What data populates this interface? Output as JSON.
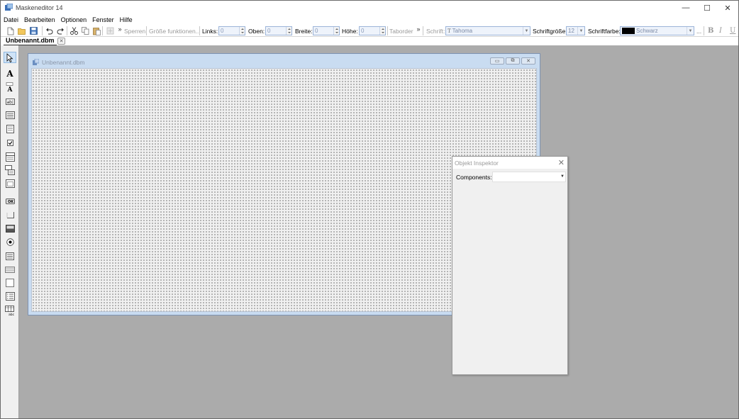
{
  "window": {
    "title": "Maskeneditor 14",
    "minimize_glyph": "—",
    "maximize_glyph": "☐",
    "close_glyph": "✕"
  },
  "menu": [
    {
      "label": "Datei"
    },
    {
      "label": "Bearbeiten"
    },
    {
      "label": "Optionen"
    },
    {
      "label": "Fenster"
    },
    {
      "label": "Hilfe"
    }
  ],
  "toolbar": {
    "lock_label": "Sperren",
    "size_functions_label": "Größe funktionen...",
    "left_label": "Links:",
    "left_value": "0",
    "top_label": "Oben:",
    "top_value": "0",
    "width_label": "Breite:",
    "width_value": "0",
    "height_label": "Höhe:",
    "height_value": "0",
    "taborder_label": "Taborder",
    "font_label": "Schrift:",
    "font_value": "Tahoma",
    "font_size_label": "Schriftgröße:",
    "font_size_value": "12",
    "font_color_label": "Schriftfarbe:",
    "font_color_value": "Schwarz",
    "font_color_swatch": "#000000",
    "overflow_glyph": "»",
    "ellipsis_label": "...",
    "bold_label": "B",
    "italic_label": "I",
    "underline_label": "U"
  },
  "document_tab": {
    "label": "Unbenannt.dbm"
  },
  "form_window": {
    "title": "Unbenannt.dbm"
  },
  "inspector": {
    "title": "Objekt Inspektor",
    "components_label": "Components:",
    "components_value": ""
  },
  "palette_tools": [
    "pointer",
    "label",
    "db-label",
    "edit",
    "memo",
    "listbox",
    "checkbox",
    "combobox",
    "lookup-combo",
    "groupbox",
    "radio-group",
    "button",
    "image",
    "db-image",
    "radio",
    "dbnavigator",
    "panel",
    "shape",
    "list",
    "grid"
  ],
  "colors": {
    "workspace": "#ababab",
    "form_titlebar": "#c9dcf1",
    "accent": "#8fb8e0"
  }
}
